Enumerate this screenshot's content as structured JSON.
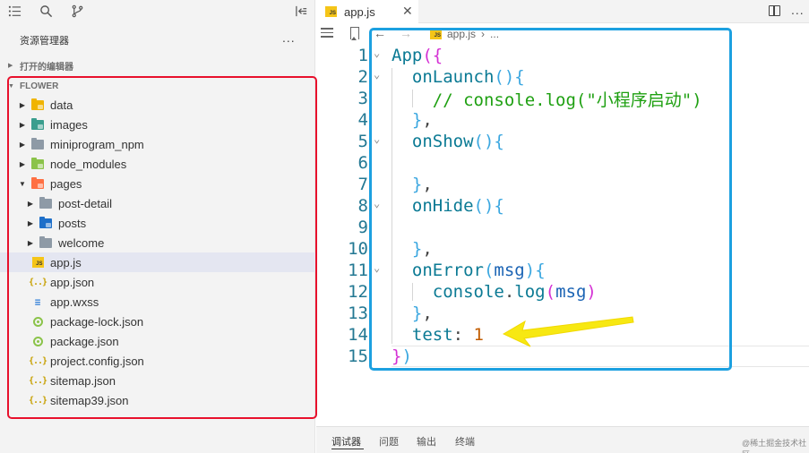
{
  "sidebar": {
    "explorer_title": "资源管理器",
    "more": "...",
    "open_editors_label": "打开的编辑器",
    "folder_label": "FLOWER",
    "tree": [
      {
        "label": "data",
        "depth": 0,
        "twisty": "▶",
        "icon": "folder-data-icon",
        "type": "folder",
        "color": "#f0b400",
        "badge": "#f0b400"
      },
      {
        "label": "images",
        "depth": 0,
        "twisty": "▶",
        "icon": "folder-images-icon",
        "type": "folder",
        "color": "#3a9e8e",
        "badge": "#3a9e8e"
      },
      {
        "label": "miniprogram_npm",
        "depth": 0,
        "twisty": "▶",
        "icon": "folder-icon",
        "type": "folder",
        "color": "#8e9aa6",
        "badge": ""
      },
      {
        "label": "node_modules",
        "depth": 0,
        "twisty": "▶",
        "icon": "folder-node-icon",
        "type": "folder",
        "color": "#8bc34a",
        "badge": "#6a9f2f"
      },
      {
        "label": "pages",
        "depth": 0,
        "twisty": "▼",
        "icon": "folder-pages-icon",
        "type": "folder",
        "color": "#ff7043",
        "badge": "#e64a19"
      },
      {
        "label": "post-detail",
        "depth": 1,
        "twisty": "▶",
        "icon": "folder-icon",
        "type": "folder",
        "color": "#8e9aa6",
        "badge": ""
      },
      {
        "label": "posts",
        "depth": 1,
        "twisty": "▶",
        "icon": "folder-posts-icon",
        "type": "folder",
        "color": "#1e6fc9",
        "badge": "#1e6fc9"
      },
      {
        "label": "welcome",
        "depth": 1,
        "twisty": "▶",
        "icon": "folder-icon",
        "type": "folder",
        "color": "#8e9aa6",
        "badge": ""
      },
      {
        "label": "app.js",
        "depth": 0,
        "twisty": "",
        "icon": "js-file-icon",
        "type": "js",
        "selected": true
      },
      {
        "label": "app.json",
        "depth": 0,
        "twisty": "",
        "icon": "json-file-icon",
        "type": "json"
      },
      {
        "label": "app.wxss",
        "depth": 0,
        "twisty": "",
        "icon": "css-file-icon",
        "type": "css"
      },
      {
        "label": "package-lock.json",
        "depth": 0,
        "twisty": "",
        "icon": "npm-file-icon",
        "type": "npm"
      },
      {
        "label": "package.json",
        "depth": 0,
        "twisty": "",
        "icon": "npm-file-icon",
        "type": "npm"
      },
      {
        "label": "project.config.json",
        "depth": 0,
        "twisty": "",
        "icon": "json-file-icon",
        "type": "json"
      },
      {
        "label": "sitemap.json",
        "depth": 0,
        "twisty": "",
        "icon": "json-file-icon",
        "type": "json"
      },
      {
        "label": "sitemap39.json",
        "depth": 0,
        "twisty": "",
        "icon": "json-file-icon",
        "type": "json"
      }
    ]
  },
  "editor": {
    "tab_label": "app.js",
    "tab_close": "✕",
    "tab_more": "...",
    "crumb_file": "app.js",
    "crumb_sep": "›",
    "crumb_more": "...",
    "nav_back": "←",
    "nav_fwd": "→",
    "lines": [
      {
        "n": "1",
        "fold": "⌄",
        "tokens": [
          [
            "App",
            "t-id"
          ],
          [
            "(",
            "t-br1"
          ],
          [
            "{",
            "t-br1"
          ]
        ]
      },
      {
        "n": "2",
        "fold": "⌄",
        "tokens": [
          [
            "  onLaunch",
            "t-id"
          ],
          [
            "()",
            "t-br2"
          ],
          [
            "{",
            "t-br2"
          ]
        ]
      },
      {
        "n": "3",
        "fold": "",
        "tokens": [
          [
            "    // console.log(\"小程序启动\")",
            "t-cm"
          ]
        ]
      },
      {
        "n": "4",
        "fold": "",
        "tokens": [
          [
            "  ",
            "t-plain"
          ],
          [
            "}",
            "t-br2"
          ],
          [
            ",",
            "t-pu"
          ]
        ]
      },
      {
        "n": "5",
        "fold": "⌄",
        "tokens": [
          [
            "  onShow",
            "t-id"
          ],
          [
            "()",
            "t-br2"
          ],
          [
            "{",
            "t-br2"
          ]
        ]
      },
      {
        "n": "6",
        "fold": "",
        "tokens": [
          [
            "",
            "t-plain"
          ]
        ]
      },
      {
        "n": "7",
        "fold": "",
        "tokens": [
          [
            "  ",
            "t-plain"
          ],
          [
            "}",
            "t-br2"
          ],
          [
            ",",
            "t-pu"
          ]
        ]
      },
      {
        "n": "8",
        "fold": "⌄",
        "tokens": [
          [
            "  onHide",
            "t-id"
          ],
          [
            "()",
            "t-br2"
          ],
          [
            "{",
            "t-br2"
          ]
        ]
      },
      {
        "n": "9",
        "fold": "",
        "tokens": [
          [
            "",
            "t-plain"
          ]
        ]
      },
      {
        "n": "10",
        "fold": "",
        "tokens": [
          [
            "  ",
            "t-plain"
          ],
          [
            "}",
            "t-br2"
          ],
          [
            ",",
            "t-pu"
          ]
        ]
      },
      {
        "n": "11",
        "fold": "⌄",
        "tokens": [
          [
            "  onError",
            "t-id"
          ],
          [
            "(",
            "t-br2"
          ],
          [
            "msg",
            "t-pa"
          ],
          [
            ")",
            "t-br2"
          ],
          [
            "{",
            "t-br2"
          ]
        ]
      },
      {
        "n": "12",
        "fold": "",
        "tokens": [
          [
            "    console",
            "t-id"
          ],
          [
            ".",
            "t-pu"
          ],
          [
            "log",
            "t-id"
          ],
          [
            "(",
            "t-br1"
          ],
          [
            "msg",
            "t-pa"
          ],
          [
            ")",
            "t-br1"
          ]
        ]
      },
      {
        "n": "13",
        "fold": "",
        "tokens": [
          [
            "  ",
            "t-plain"
          ],
          [
            "}",
            "t-br2"
          ],
          [
            ",",
            "t-pu"
          ]
        ]
      },
      {
        "n": "14",
        "fold": "",
        "tokens": [
          [
            "  test",
            "t-key"
          ],
          [
            ": ",
            "t-pu"
          ],
          [
            "1",
            "t-num"
          ]
        ]
      },
      {
        "n": "15",
        "fold": "",
        "tokens": [
          [
            "}",
            "t-br1"
          ],
          [
            ")",
            "t-br2"
          ]
        ]
      }
    ]
  },
  "panel": {
    "tabs": [
      "调试器",
      "问题",
      "输出",
      "终端"
    ],
    "watermark": "@稀土掘金技术社区"
  },
  "colors": {
    "annotation_red": "#e8102c",
    "annotation_blue": "#1ca0e0",
    "annotation_arrow": "#f7e812"
  }
}
